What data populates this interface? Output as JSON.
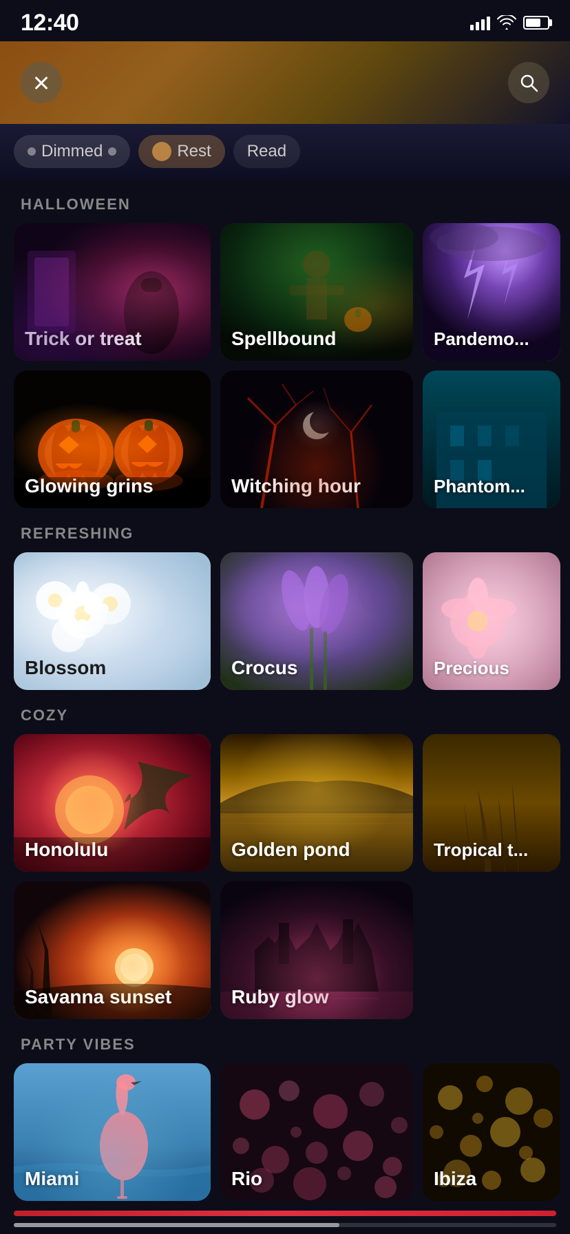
{
  "statusBar": {
    "time": "12:40"
  },
  "header": {
    "closeLabel": "×",
    "searchLabel": "🔍"
  },
  "filterPills": [
    {
      "label": "Dimmed",
      "type": "dimmed"
    },
    {
      "label": "Rest",
      "type": "rest"
    },
    {
      "label": "Read",
      "type": "read"
    }
  ],
  "sections": [
    {
      "id": "halloween",
      "title": "HALLOWEEN",
      "rows": [
        [
          {
            "id": "trick",
            "label": "Trick or treat"
          },
          {
            "id": "spellbound",
            "label": "Spellbound"
          },
          {
            "id": "pandemonium",
            "label": "Pandemo..."
          }
        ],
        [
          {
            "id": "glowing",
            "label": "Glowing grins"
          },
          {
            "id": "witching",
            "label": "Witching hour"
          },
          {
            "id": "phantom",
            "label": "Phantom..."
          }
        ]
      ]
    },
    {
      "id": "refreshing",
      "title": "REFRESHING",
      "rows": [
        [
          {
            "id": "blossom",
            "label": "Blossom"
          },
          {
            "id": "crocus",
            "label": "Crocus"
          },
          {
            "id": "precious",
            "label": "Precious"
          }
        ]
      ]
    },
    {
      "id": "cozy",
      "title": "COZY",
      "rows": [
        [
          {
            "id": "honolulu",
            "label": "Honolulu"
          },
          {
            "id": "golden",
            "label": "Golden pond"
          },
          {
            "id": "tropical",
            "label": "Tropical t..."
          }
        ],
        [
          {
            "id": "savanna",
            "label": "Savanna sunset"
          },
          {
            "id": "ruby",
            "label": "Ruby glow"
          }
        ]
      ]
    },
    {
      "id": "party",
      "title": "PARTY VIBES",
      "rows": [
        [
          {
            "id": "miami",
            "label": "Miami"
          },
          {
            "id": "rio",
            "label": "Rio"
          },
          {
            "id": "ibiza",
            "label": "Ibiza"
          }
        ]
      ]
    }
  ]
}
